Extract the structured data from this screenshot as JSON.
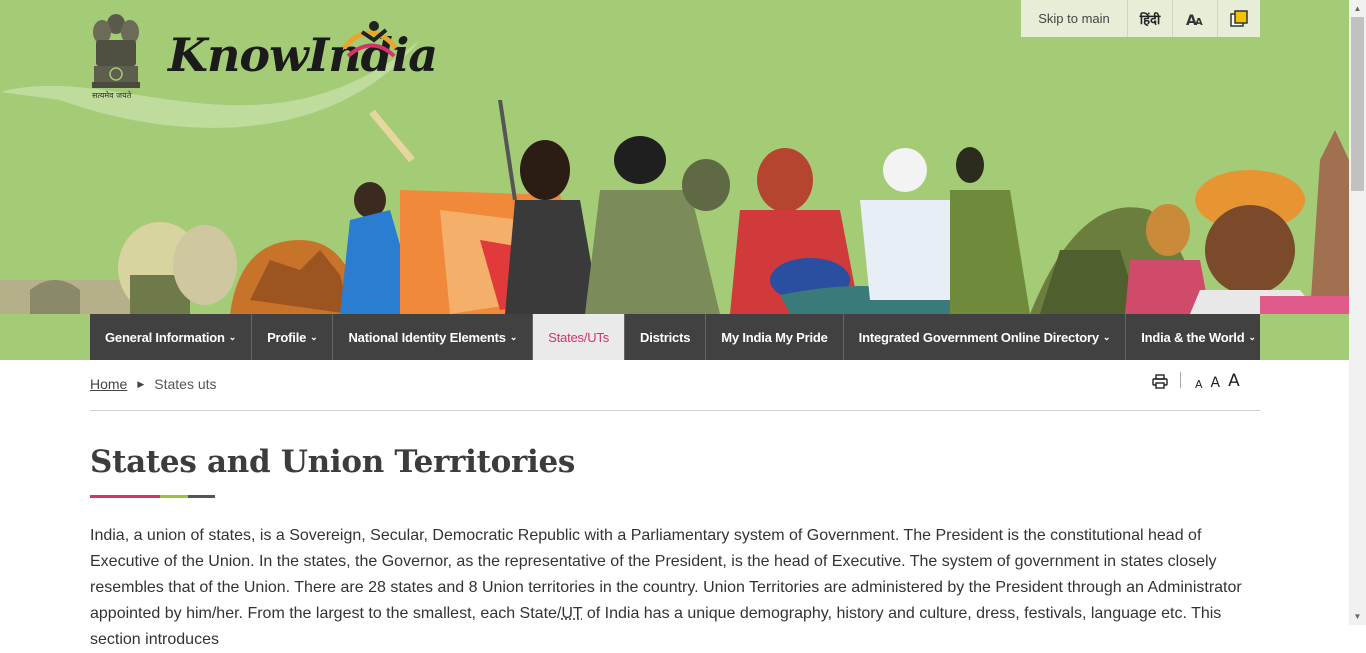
{
  "header": {
    "logo_text": "KnowIndia",
    "emblem_caption": "सत्यमेव जयते",
    "top_tools": {
      "skip": "Skip to main",
      "hindi": "हिंदी",
      "font_icon_label": "A"
    }
  },
  "nav": {
    "items": [
      {
        "label": "General Information",
        "dropdown": true
      },
      {
        "label": "Profile",
        "dropdown": true
      },
      {
        "label": "National Identity Elements",
        "dropdown": true
      },
      {
        "label": "States/UTs",
        "dropdown": false,
        "active": true
      },
      {
        "label": "Districts",
        "dropdown": false
      },
      {
        "label": "My India My Pride",
        "dropdown": false
      },
      {
        "label": "Integrated Government Online Directory",
        "dropdown": true
      },
      {
        "label": "India & the World",
        "dropdown": true
      }
    ],
    "caret": "⌄"
  },
  "breadcrumb": {
    "home": "Home",
    "current": "States uts"
  },
  "page_tools": {
    "font_small": "A",
    "font_medium": "A",
    "font_large": "A"
  },
  "content": {
    "title": "States and Union Territories",
    "intro_part1": "India, a union of states, is a Sovereign, Secular, Democratic Republic with a Parliamentary system of Government. The President is the constitutional head of Executive of the Union. In the states, the Governor, as the representative of the President, is the head of Executive. The system of government in states closely resembles that of the Union. There are 28 states and 8 Union territories in the country. Union Territories are administered by the President through an Administrator appointed by him/her. From the largest to the smallest, each State/",
    "intro_abbr": "UT",
    "intro_part2": " of India has a unique demography, history and culture, dress, festivals, language etc. This section introduces"
  },
  "colors": {
    "header_bg": "#a4cb76",
    "nav_bg": "#414141",
    "active_text": "#d6336c",
    "title_bar": [
      "#d6336c",
      "#9cc23c",
      "#555555"
    ]
  }
}
